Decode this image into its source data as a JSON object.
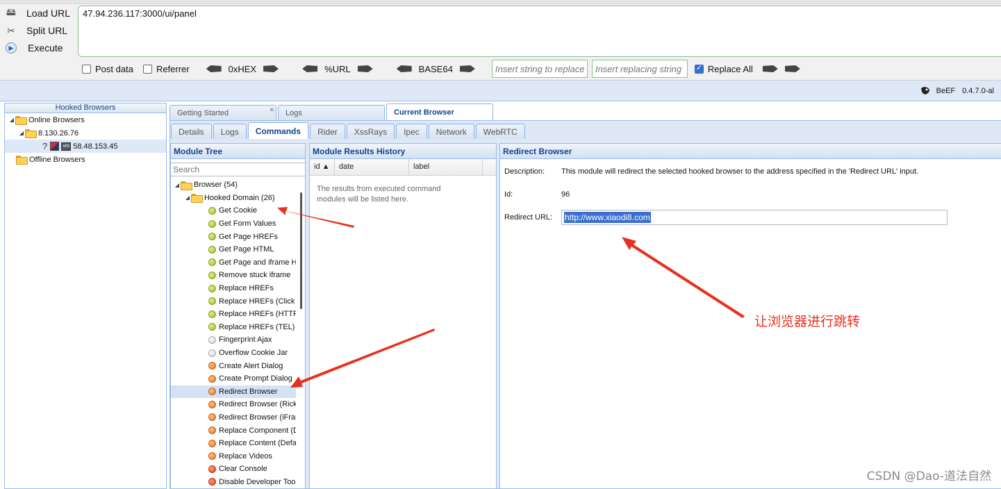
{
  "hackbar": {
    "actions": [
      {
        "label": "Load URL",
        "icon": "load-url-icon"
      },
      {
        "label": "Split URL",
        "icon": "split-url-icon"
      },
      {
        "label": "Execute",
        "icon": "execute-icon"
      }
    ],
    "url": "47.94.236.117:3000/ui/panel",
    "post_data": "Post data",
    "referrer": "Referrer",
    "hex": "0xHEX",
    "url_encode": "%URL",
    "base64": "BASE64",
    "insert_placeholder": "Insert string to replace",
    "replacing_placeholder": "Insert replacing string",
    "replace_all": "Replace All",
    "replace_all_checked": true
  },
  "beef": {
    "brand": "BeEF",
    "version": "0.4.7.0-al"
  },
  "hooked": {
    "title": "Hooked Browsers",
    "online": "Online Browsers",
    "host": "8.130.26.76",
    "browser": "58.48.153.45",
    "offline": "Offline Browsers"
  },
  "main_tabs": [
    "Getting Started",
    "Logs",
    "Current Browser"
  ],
  "sub_tabs": [
    "Details",
    "Logs",
    "Commands",
    "Rider",
    "XssRays",
    "Ipec",
    "Network",
    "WebRTC"
  ],
  "module_tree": {
    "title": "Module Tree",
    "search_placeholder": "Search",
    "root": "Browser (54)",
    "group": "Hooked Domain (26)",
    "items": [
      {
        "label": "Get Cookie",
        "color": "green"
      },
      {
        "label": "Get Form Values",
        "color": "green"
      },
      {
        "label": "Get Page HREFs",
        "color": "green"
      },
      {
        "label": "Get Page HTML",
        "color": "green"
      },
      {
        "label": "Get Page and iframe HTML",
        "color": "green"
      },
      {
        "label": "Remove stuck iframe",
        "color": "green"
      },
      {
        "label": "Replace HREFs",
        "color": "green"
      },
      {
        "label": "Replace HREFs (Click Events)",
        "color": "green"
      },
      {
        "label": "Replace HREFs (HTTPS)",
        "color": "green"
      },
      {
        "label": "Replace HREFs (TEL)",
        "color": "green"
      },
      {
        "label": "Fingerprint Ajax",
        "color": "grey"
      },
      {
        "label": "Overflow Cookie Jar",
        "color": "grey"
      },
      {
        "label": "Create Alert Dialog",
        "color": "orange"
      },
      {
        "label": "Create Prompt Dialog",
        "color": "orange"
      },
      {
        "label": "Redirect Browser",
        "color": "orange",
        "selected": true
      },
      {
        "label": "Redirect Browser (Rickroll)",
        "color": "orange"
      },
      {
        "label": "Redirect Browser (iFrame)",
        "color": "orange"
      },
      {
        "label": "Replace Component (Deface)",
        "color": "orange"
      },
      {
        "label": "Replace Content (Deface)",
        "color": "orange"
      },
      {
        "label": "Replace Videos",
        "color": "orange"
      },
      {
        "label": "Clear Console",
        "color": "red"
      },
      {
        "label": "Disable Developer Tools",
        "color": "red"
      }
    ]
  },
  "results": {
    "title": "Module Results History",
    "columns": [
      "id ▲",
      "date",
      "label"
    ],
    "empty": "The results from executed command modules will be listed here."
  },
  "detail": {
    "title": "Redirect Browser",
    "description_label": "Description:",
    "description": "This module will redirect the selected hooked browser to the address specified in the 'Redirect URL' input.",
    "id_label": "Id:",
    "id": "96",
    "redirect_label": "Redirect URL:",
    "redirect_url": "http://www.xiaodi8.com"
  },
  "annotation": {
    "note": "让浏览器进行跳转",
    "color": "#e8301e"
  },
  "watermark": "CSDN @Dao-道法自然"
}
